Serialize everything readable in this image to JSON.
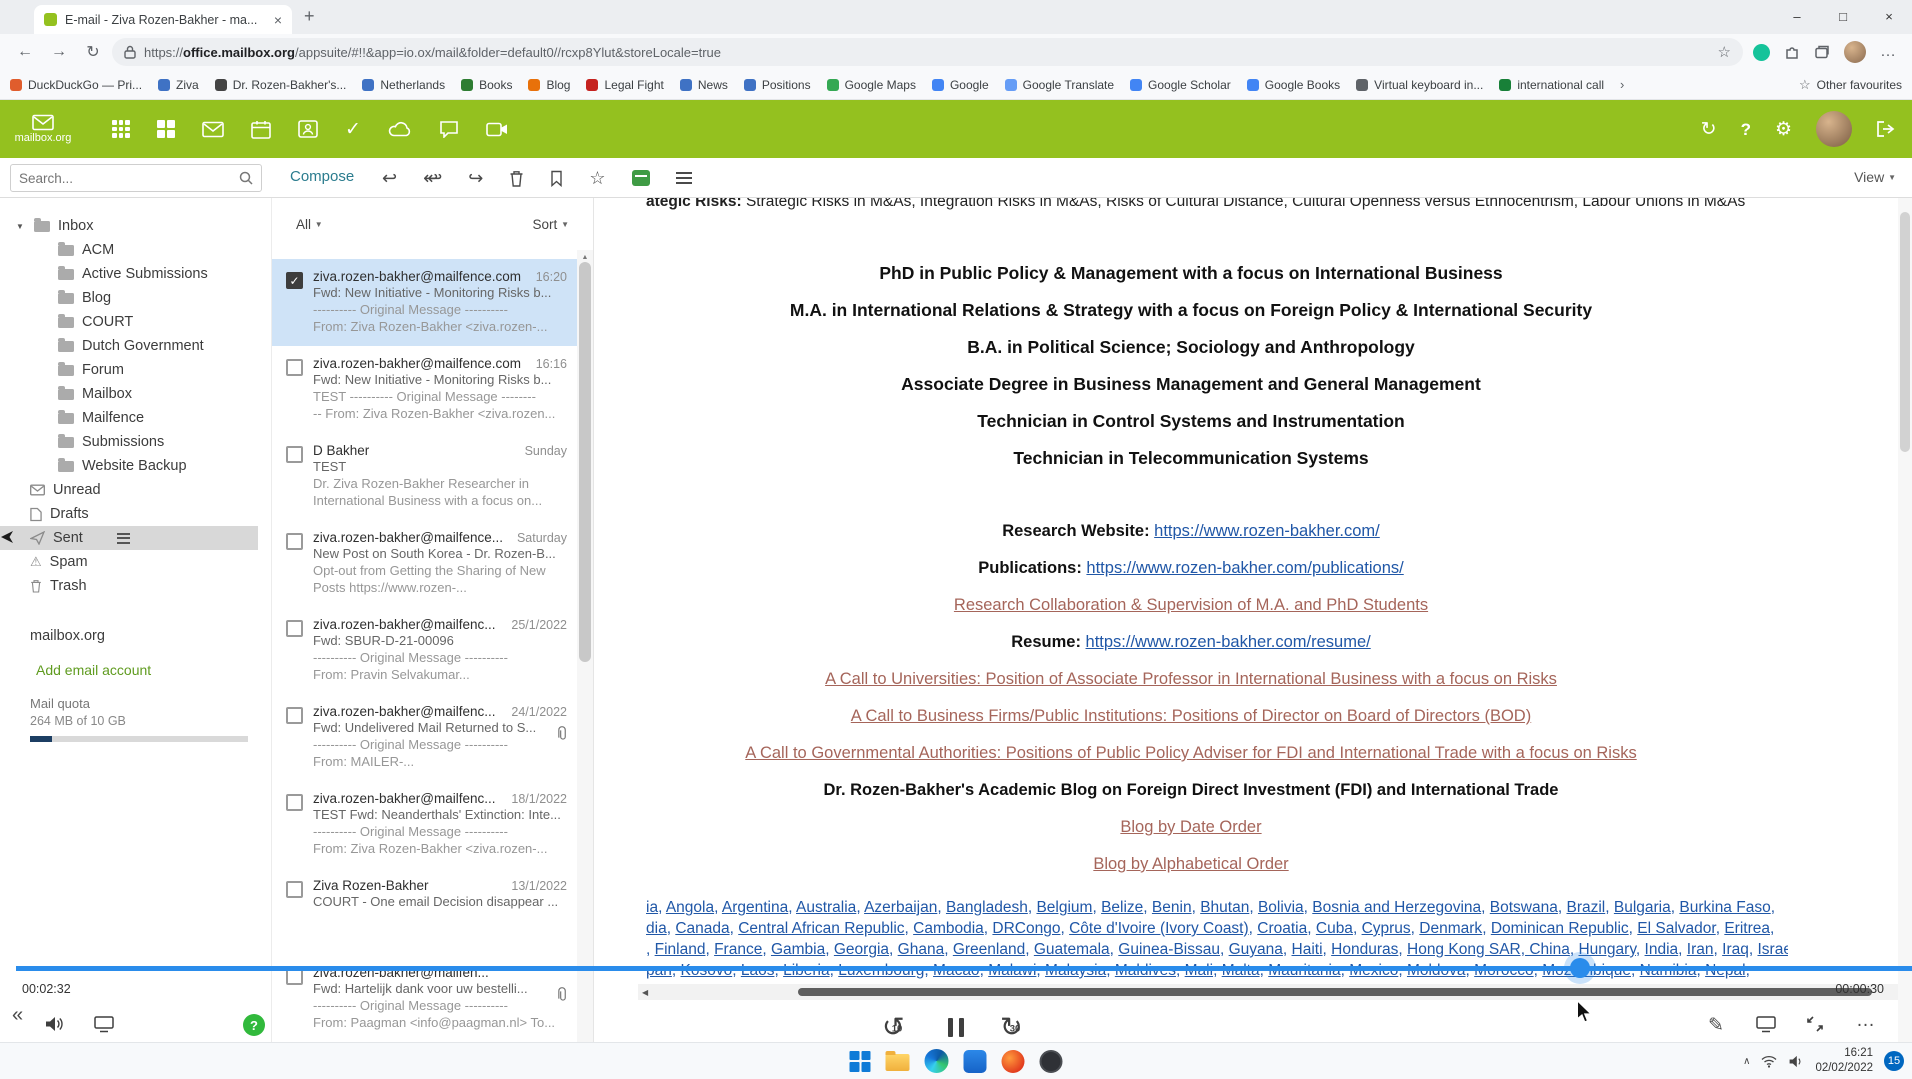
{
  "icons": {
    "back": "←",
    "forward": "→",
    "reload": "↻",
    "star": "☆",
    "more": "…",
    "minimize": "–",
    "maximize": "□",
    "close": "×",
    "plus": "+",
    "caret_down": "▼",
    "gear": "⚙",
    "help": "?",
    "sync": "↻",
    "check": "✓",
    "warn": "⚠",
    "collapse_left": "«",
    "pencil": "✎",
    "chevron_up": "∧",
    "small_left": "◀",
    "reply": "↩",
    "forward_mail": "↪",
    "rotate_ccw": "↺",
    "rotate_cw": "↻",
    "overflow": "›",
    "scroll_up": "▲"
  },
  "colors": {
    "header_green": "#94c11f",
    "compose_teal": "#2b7c8e",
    "selected_mail": "#cfe3f7",
    "link_blue": "#2057a7",
    "link_rose": "#a5655a",
    "progress_blue": "#2a8ceb",
    "archive_green": "#3f9b44",
    "add_account_green": "#5f9b1f",
    "badge_blue": "#0067c0"
  },
  "browser": {
    "tab_title": "E-mail - Ziva Rozen-Bakher - ma...",
    "url_scheme": "https://",
    "url_domain": "office.mailbox.org",
    "url_path": "/appsuite/#!!&app=io.ox/mail&folder=default0//rcxp8Ylut&storeLocale=true",
    "other_favourites": "Other favourites",
    "bookmarks": [
      {
        "label": "DuckDuckGo — Pri...",
        "color": "#e05d2d"
      },
      {
        "label": "Ziva",
        "color": "#3f72c4"
      },
      {
        "label": "Dr. Rozen-Bakher's...",
        "color": "#444444"
      },
      {
        "label": "Netherlands",
        "color": "#3f72c4"
      },
      {
        "label": "Books",
        "color": "#2e7d32"
      },
      {
        "label": "Blog",
        "color": "#e8710a"
      },
      {
        "label": "Legal Fight",
        "color": "#c5221f"
      },
      {
        "label": "News",
        "color": "#3f72c4"
      },
      {
        "label": "Positions",
        "color": "#3f72c4"
      },
      {
        "label": "Google Maps",
        "color": "#34a853"
      },
      {
        "label": "Google",
        "color": "#4285f4"
      },
      {
        "label": "Google Translate",
        "color": "#669df6"
      },
      {
        "label": "Google Scholar",
        "color": "#4285f4"
      },
      {
        "label": "Google Books",
        "color": "#4285f4"
      },
      {
        "label": "Virtual keyboard in...",
        "color": "#5f6368"
      },
      {
        "label": "international call",
        "color": "#188038"
      }
    ]
  },
  "webmail": {
    "brand": "mailbox.org",
    "search_placeholder": "Search...",
    "toolbar": {
      "compose": "Compose",
      "view": "View"
    },
    "list": {
      "filter": "All",
      "sort": "Sort"
    },
    "sidebar": {
      "inbox": "Inbox",
      "subfolders": [
        "ACM",
        "Active Submissions",
        "Blog",
        "COURT",
        "Dutch Government",
        "Forum",
        "Mailbox",
        "Mailfence",
        "Submissions",
        "Website Backup"
      ],
      "special": [
        {
          "label": "Unread",
          "icon": "unread",
          "selected": false
        },
        {
          "label": "Drafts",
          "icon": "drafts",
          "selected": false
        },
        {
          "label": "Sent",
          "icon": "sent",
          "selected": true
        },
        {
          "label": "Spam",
          "icon": "spam",
          "selected": false
        },
        {
          "label": "Trash",
          "icon": "trash",
          "selected": false
        }
      ],
      "account_label": "mailbox.org",
      "add_account": "Add email account",
      "quota_label": "Mail quota",
      "quota_value": "264 MB of 10 GB",
      "quota_percent": 10
    },
    "emails": [
      {
        "sender": "ziva.rozen-bakher@mailfence.com",
        "time": "16:20",
        "checked": true,
        "selected": true,
        "attachment": false,
        "lines": [
          "Fwd: New Initiative - Monitoring Risks b...",
          "---------- Original Message ----------",
          "From: Ziva Rozen-Bakher <ziva.rozen-..."
        ]
      },
      {
        "sender": "ziva.rozen-bakher@mailfence.com",
        "time": "16:16",
        "checked": false,
        "selected": false,
        "attachment": false,
        "lines": [
          "Fwd: New Initiative - Monitoring Risks b...",
          "TEST ---------- Original Message --------",
          "-- From: Ziva Rozen-Bakher <ziva.rozen..."
        ]
      },
      {
        "sender": "D Bakher",
        "time": "Sunday",
        "checked": false,
        "selected": false,
        "attachment": false,
        "lines": [
          "TEST",
          "Dr. Ziva Rozen-Bakher Researcher in",
          "International Business with a focus on..."
        ]
      },
      {
        "sender": "ziva.rozen-bakher@mailfence...",
        "time": "Saturday",
        "checked": false,
        "selected": false,
        "attachment": false,
        "lines": [
          "New Post on South Korea - Dr. Rozen-B...",
          "Opt-out from Getting the Sharing of New",
          "Posts  https://www.rozen-..."
        ]
      },
      {
        "sender": "ziva.rozen-bakher@mailfenc...",
        "time": "25/1/2022",
        "checked": false,
        "selected": false,
        "attachment": false,
        "lines": [
          "Fwd: SBUR-D-21-00096",
          "---------- Original Message ----------",
          "From: Pravin Selvakumar..."
        ]
      },
      {
        "sender": "ziva.rozen-bakher@mailfenc...",
        "time": "24/1/2022",
        "checked": false,
        "selected": false,
        "attachment": true,
        "lines": [
          "Fwd: Undelivered Mail Returned to S...",
          "---------- Original Message ----------",
          "From: MAILER-..."
        ]
      },
      {
        "sender": "ziva.rozen-bakher@mailfenc...",
        "time": "18/1/2022",
        "checked": false,
        "selected": false,
        "attachment": false,
        "lines": [
          "TEST Fwd: Neanderthals' Extinction: Inte...",
          "---------- Original Message ----------",
          "From: Ziva Rozen-Bakher <ziva.rozen-..."
        ]
      },
      {
        "sender": "Ziva Rozen-Bakher",
        "time": "13/1/2022",
        "checked": false,
        "selected": false,
        "attachment": false,
        "lines": [
          "COURT - One email Decision disappear ..."
        ]
      },
      {
        "sender": "ziva.rozen-bakher@mailfen...",
        "time": "",
        "checked": false,
        "selected": false,
        "attachment": true,
        "lines": [
          "Fwd: Hartelijk dank voor uw bestelli...",
          "---------- Original Message ----------",
          "From: Paagman <info@paagman.nl> To..."
        ]
      }
    ]
  },
  "message": {
    "clipped_bold": "ategic Risks:",
    "clipped_rest": " Strategic Risks in M&As, Integration Risks in M&As, Risks of Cultural Distance, Cultural Openness versus Ethnocentrism, Labour Unions in M&As",
    "degrees": [
      "PhD in Public Policy & Management with a focus on International Business",
      "M.A. in International Relations & Strategy with a focus on Foreign Policy & International Security",
      "B.A. in Political Science; Sociology and Anthropology",
      "Associate Degree in Business Management and General Management",
      "Technician in Control Systems and Instrumentation",
      "Technician in Telecommunication Systems"
    ],
    "rows": [
      {
        "type": "labeled",
        "label": "Research Website:",
        "link": "https://www.rozen-bakher.com/"
      },
      {
        "type": "labeled",
        "label": "Publications:",
        "link": "https://www.rozen-bakher.com/publications/"
      },
      {
        "type": "rose",
        "text": "Research Collaboration & Supervision of M.A. and PhD Students"
      },
      {
        "type": "labeled",
        "label": "Resume:",
        "link": "https://www.rozen-bakher.com/resume/"
      },
      {
        "type": "rose",
        "text": "A Call to Universities: Position of Associate Professor in International Business with a focus on Risks"
      },
      {
        "type": "rose",
        "text": "A Call to Business Firms/Public Institutions: Positions of Director on Board of Directors (BOD)"
      },
      {
        "type": "rose",
        "text": "A Call to Governmental Authorities: Positions of Public Policy Adviser for FDI and International Trade with a focus on Risks"
      },
      {
        "type": "bold",
        "text": "Dr. Rozen-Bakher's Academic Blog on Foreign Direct Investment (FDI) and International Trade"
      },
      {
        "type": "rose",
        "text": "Blog by Date Order"
      },
      {
        "type": "rose",
        "text": "Blog by Alphabetical Order"
      }
    ],
    "country_rows": [
      {
        "prefix": "",
        "items": [
          "ia",
          "Angola",
          "Argentina",
          "Australia",
          "Azerbaijan",
          "Bangladesh",
          "Belgium",
          "Belize",
          "Benin",
          "Bhutan",
          "Bolivia",
          "Bosnia and Herzegovina",
          "Botswana",
          "Brazil",
          "Bulgaria",
          "Burkina Faso"
        ]
      },
      {
        "prefix": "",
        "items": [
          "dia",
          "Canada",
          "Central African Republic",
          "Cambodia",
          "DRCongo",
          "Côte d'Ivoire (Ivory Coast)",
          "Croatia",
          "Cuba",
          "Cyprus",
          "Denmark",
          "Dominican Republic",
          "El Salvador",
          "Eritrea"
        ]
      },
      {
        "prefix": ", ",
        "items": [
          "Finland",
          "France",
          "Gambia",
          "Georgia",
          "Ghana",
          "Greenland",
          "Guatemala",
          "Guinea-Bissau",
          "Guyana",
          "Haiti",
          "Honduras",
          "Hong Kong SAR, China",
          "Hungary",
          "India",
          "Iran",
          "Iraq",
          "Israel"
        ]
      },
      {
        "prefix": "",
        "items": [
          "pan",
          "Kosovo",
          "Laos",
          "Liberia",
          "Luxembourg",
          "Macao",
          "Malawi",
          "Malaysia",
          "Maldives",
          "Mali",
          "Malta",
          "Mauritania",
          "Mexico",
          "Moldova",
          "Morocco",
          "Mozambique",
          "Namibia",
          "Nepal"
        ]
      }
    ]
  },
  "player": {
    "current_time": "00:02:32",
    "end_time": "00:00:30",
    "rewind": "10",
    "forward": "30",
    "help": "?"
  },
  "taskbar": {
    "time": "16:21",
    "date": "02/02/2022",
    "badge": "15"
  }
}
